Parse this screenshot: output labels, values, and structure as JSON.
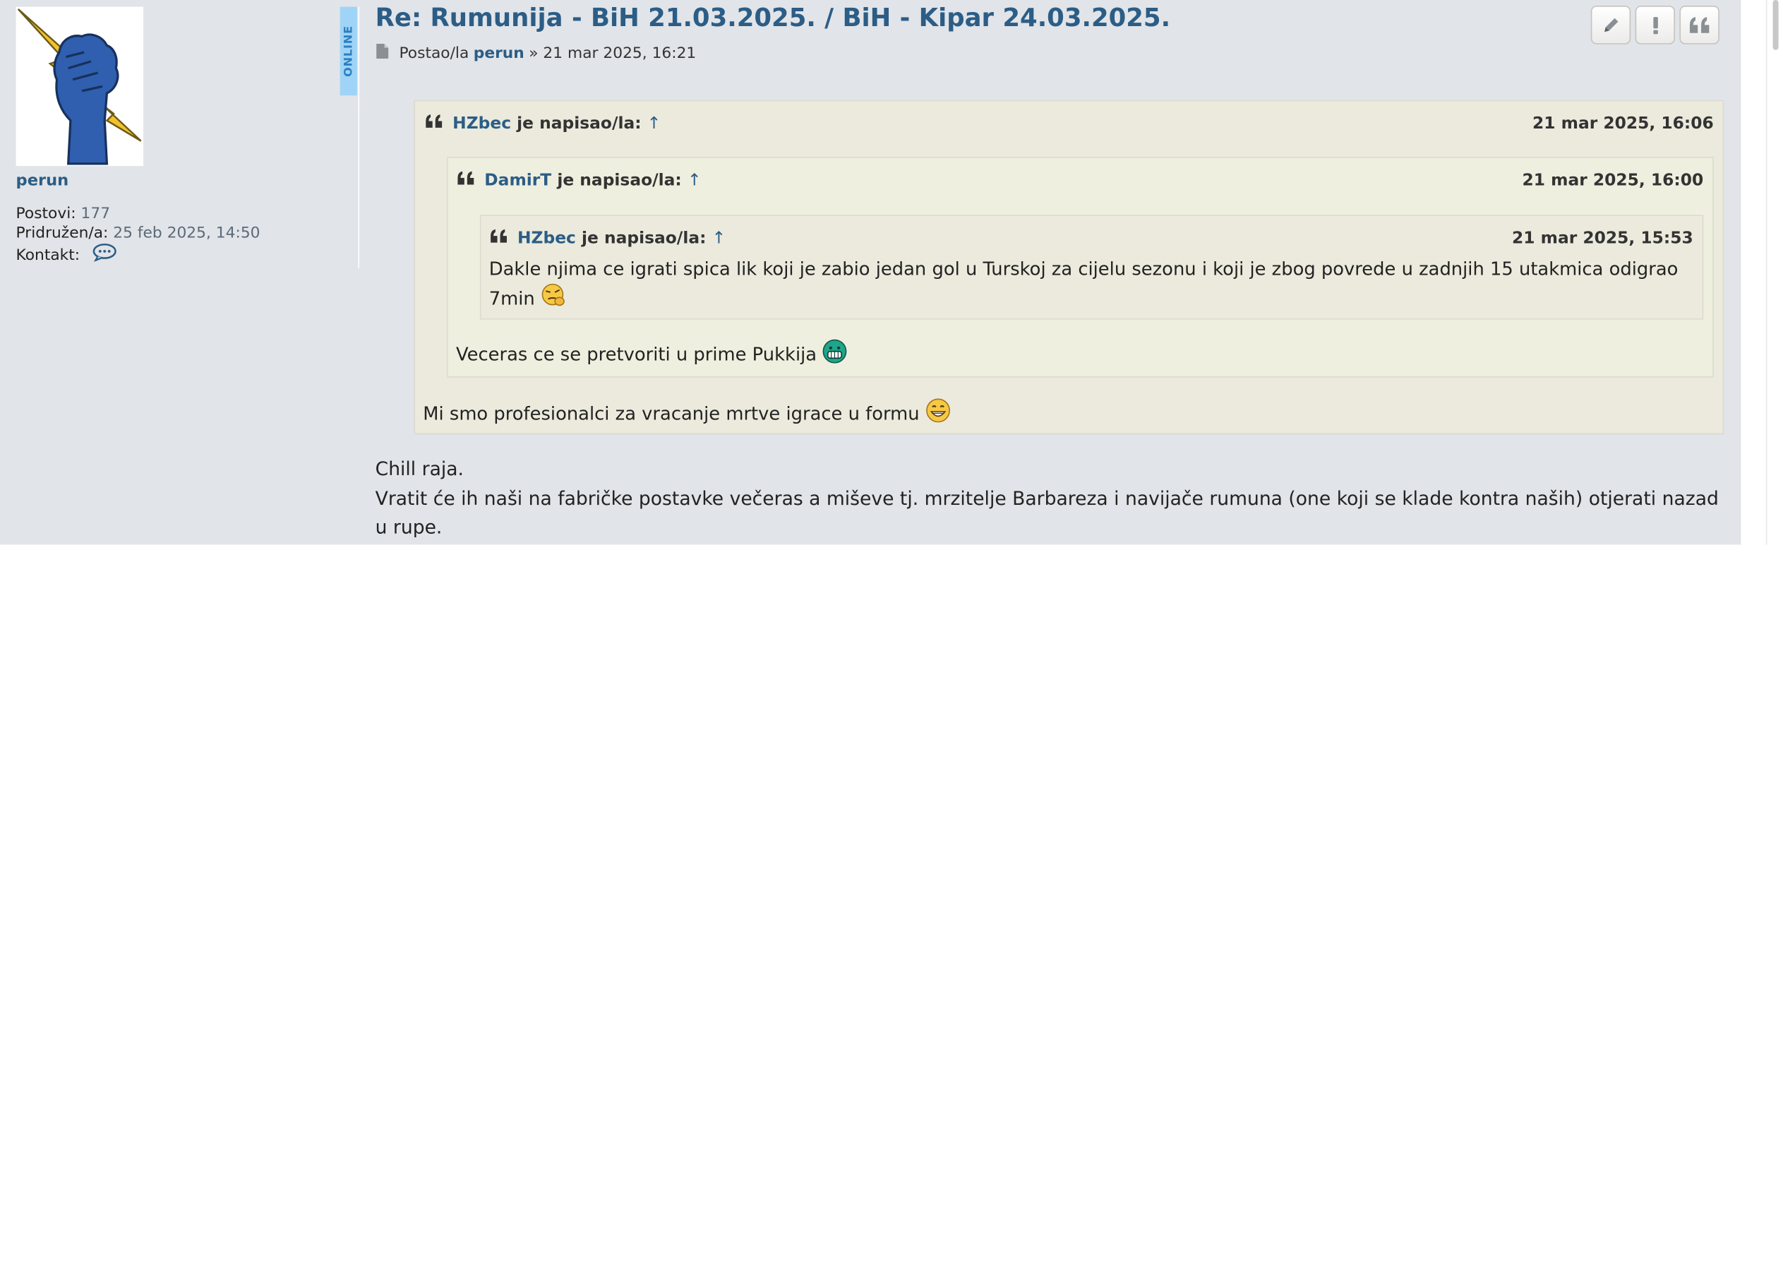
{
  "post": {
    "title": "Re: Rumunija - BiH 21.03.2025. / BiH - Kipar 24.03.2025.",
    "meta_prefix": "Postao/la",
    "meta_author": "perun",
    "meta_date": "» 21 mar 2025, 16:21",
    "buttons": {
      "edit_icon": "pencil-icon",
      "report_icon": "exclamation-icon",
      "quote_icon": "quote-icon"
    }
  },
  "profile": {
    "username": "perun",
    "online_label": "ONLINE",
    "posts_label": "Postovi:",
    "posts_value": "177",
    "joined_label": "Pridružen/a:",
    "joined_value": "25 feb 2025, 14:50",
    "contact_label": "Kontakt:",
    "avatar_icon": "fist-lightning-icon",
    "contact_icon": "speech-bubble-icon"
  },
  "quotes": {
    "outer": {
      "author": "HZbec",
      "wrote": "je napisao/la:",
      "arrow": "↑",
      "date": "21 mar 2025, 16:06",
      "text": "Mi smo profesionalci za vracanje mrtve igrace u formu"
    },
    "middle": {
      "author": "DamirT",
      "wrote": "je napisao/la:",
      "arrow": "↑",
      "date": "21 mar 2025, 16:00",
      "text": "Veceras ce se pretvoriti u prime Pukkija"
    },
    "inner": {
      "author": "HZbec",
      "wrote": "je napisao/la:",
      "arrow": "↑",
      "date": "21 mar 2025, 15:53",
      "text_line1": "Dakle njima ce igrati spica lik koji je zabio jedan gol u Turskoj za cijelu sezonu i koji je zbog povrede u zadnjih 15 utakmica odigrao",
      "text_line2": "7min"
    }
  },
  "reply": {
    "line1": "Chill raja.",
    "line2": "Vratit će ih naši na fabričke postavke večeras a miševe tj. mrzitelje Barbareza i navijače rumuna (one koji se klade kontra naših) otjerati nazad",
    "line3": "u rupe."
  },
  "colors": {
    "post_bg": "#e1e4e8",
    "link": "#2b5d86",
    "quote_bg": "#ebeadd",
    "online_badge": "#9fd4f7"
  }
}
